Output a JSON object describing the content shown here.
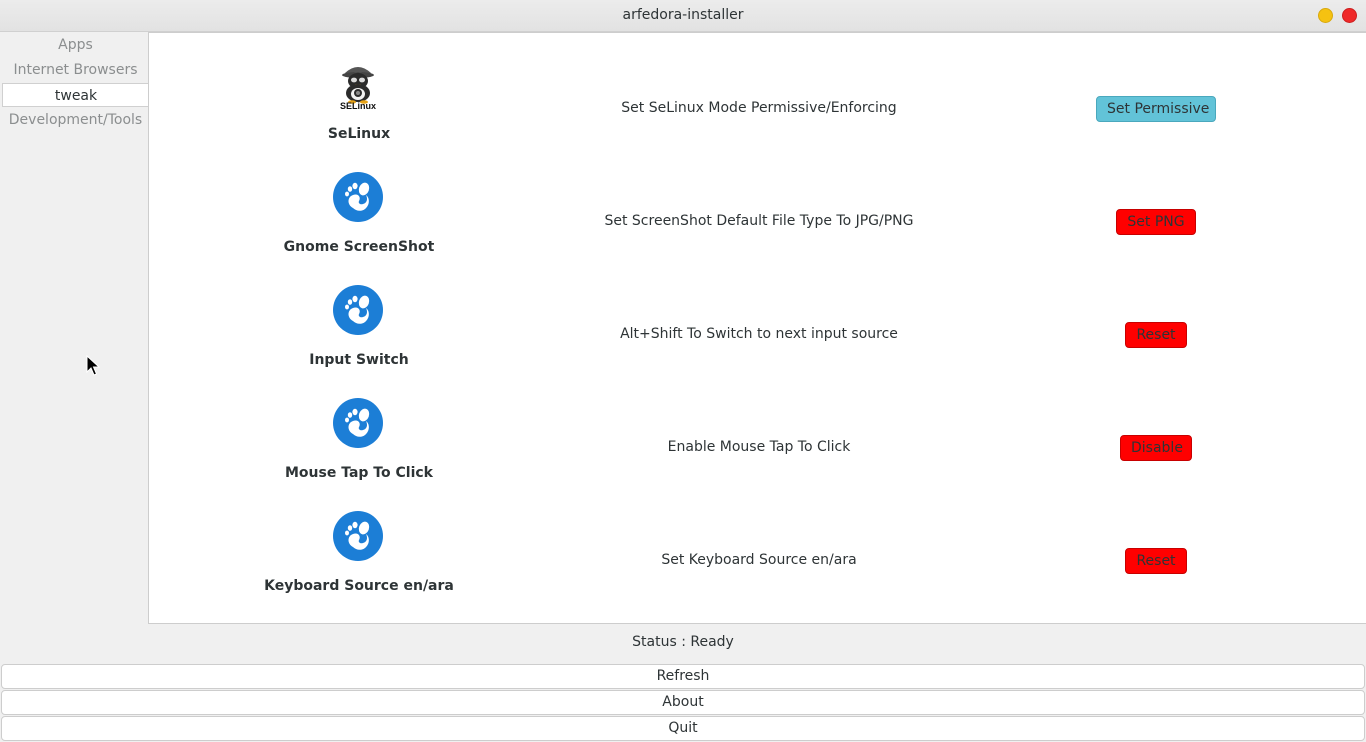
{
  "window": {
    "title": "arfedora-installer"
  },
  "sidebar": {
    "items": [
      {
        "label": "Apps",
        "active": false
      },
      {
        "label": "Internet Browsers",
        "active": false
      },
      {
        "label": "tweak",
        "active": true
      },
      {
        "label": "Development/Tools",
        "active": false
      }
    ]
  },
  "tweaks": [
    {
      "name": "SeLinux",
      "icon": "selinux-penguin-icon",
      "icon_label": "SELinux",
      "description": "Set SeLinux Mode Permissive/Enforcing",
      "action_label": "Set Permissive",
      "action_color": "#62c3d8"
    },
    {
      "name": "Gnome ScreenShot",
      "icon": "gnome-foot-icon",
      "description": "Set ScreenShot Default File Type To JPG/PNG",
      "action_label": "Set PNG",
      "action_color": "#ff0000"
    },
    {
      "name": "Input Switch",
      "icon": "gnome-foot-icon",
      "description": "Alt+Shift To Switch to next input source",
      "action_label": "Reset",
      "action_color": "#ff0000"
    },
    {
      "name": "Mouse Tap To Click",
      "icon": "gnome-foot-icon",
      "description": "Enable Mouse Tap To Click",
      "action_label": "Disable",
      "action_color": "#ff0000"
    },
    {
      "name": "Keyboard Source en/ara",
      "icon": "gnome-foot-icon",
      "description": "Set Keyboard Source en/ara",
      "action_label": "Reset",
      "action_color": "#ff0000"
    }
  ],
  "status": {
    "text": "Status : Ready"
  },
  "footer": {
    "refresh_label": "Refresh",
    "about_label": "About",
    "quit_label": "Quit"
  },
  "colors": {
    "gnome_blue": "#1c7ed6",
    "window_close": "#ef2929",
    "window_minimize": "#f5c211"
  }
}
